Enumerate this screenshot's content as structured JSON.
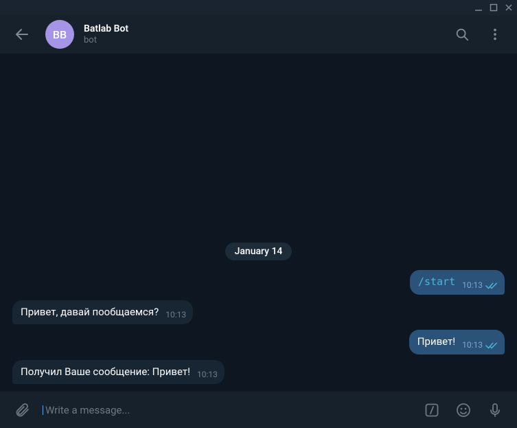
{
  "header": {
    "avatar_initials": "BB",
    "title": "Batlab Bot",
    "status": "bot"
  },
  "date_separator": "January 14",
  "messages": [
    {
      "dir": "out",
      "kind": "cmd",
      "text": "/start",
      "time": "10:13",
      "read": true
    },
    {
      "dir": "in",
      "kind": "text",
      "text": "Привет, давай пообщаемся?",
      "time": "10:13"
    },
    {
      "dir": "out",
      "kind": "text",
      "text": "Привет!",
      "time": "10:13",
      "read": true
    },
    {
      "dir": "in",
      "kind": "text",
      "text": "Получил Ваше сообщение: Привет!",
      "time": "10:13"
    }
  ],
  "composer": {
    "placeholder": "Write a message..."
  }
}
